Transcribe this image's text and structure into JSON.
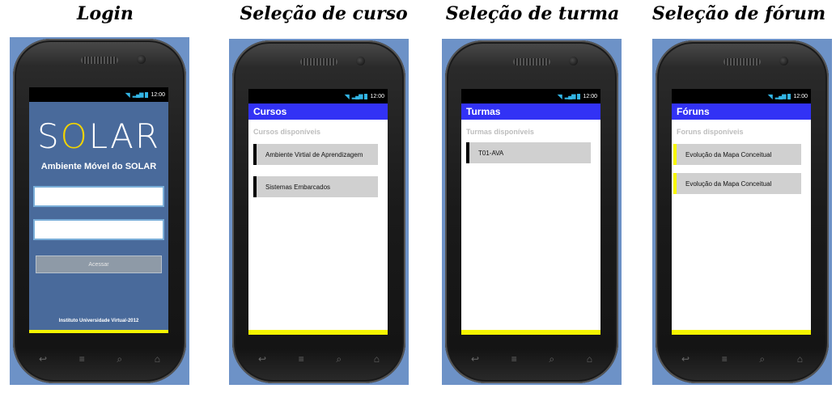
{
  "panels": {
    "login": {
      "title": "Login",
      "status_time": "12:00",
      "logo_s": "S",
      "logo_o": "O",
      "logo_rest": "LAR",
      "subtitle": "Ambiente Móvel do SOLAR",
      "username_value": "",
      "password_value": "",
      "button_label": "Acessar",
      "footer": "Instituto Universidade Virtual-2012"
    },
    "cursos": {
      "title": "Seleção de curso",
      "status_time": "12:00",
      "header": "Cursos",
      "subheader": "Cursos disponíveis",
      "items": [
        "Ambiente Virtial de Aprendizagem",
        "Sistemas Embarcados"
      ]
    },
    "turmas": {
      "title": "Seleção de turma",
      "status_time": "12:00",
      "header": "Turmas",
      "subheader": "Turmas disponíveis",
      "items": [
        "T01-AVA"
      ]
    },
    "foruns": {
      "title": "Seleção de fórum",
      "status_time": "12:00",
      "header": "Fóruns",
      "subheader": "Foruns disponíveis",
      "items": [
        "Evolução da Mapa Conceitual",
        "Evolução da Mapa Conceitual"
      ]
    }
  },
  "colors": {
    "panel_bg": "#6d92c7",
    "header_blue": "#3232f5",
    "login_bg": "#496a9b",
    "accent_yellow": "#f4f400",
    "item_bg": "#d0d0d0"
  },
  "nav_icons": [
    "back-icon",
    "menu-icon",
    "search-icon",
    "home-icon"
  ]
}
